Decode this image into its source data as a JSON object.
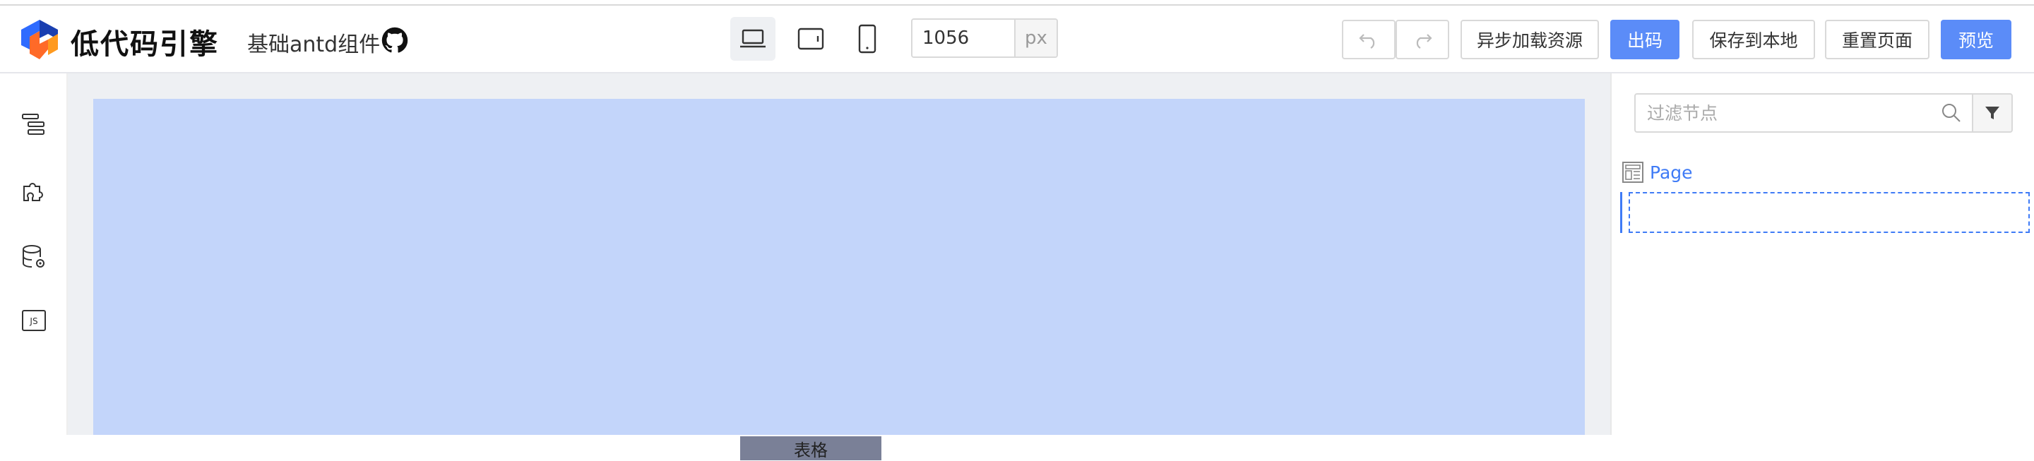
{
  "header": {
    "brand": "低代码引擎",
    "subtitle": "基础antd组件",
    "devices": [
      "desktop",
      "tablet",
      "phone"
    ],
    "active_device": "desktop",
    "canvas_width": "1056",
    "canvas_width_unit": "px",
    "buttons": {
      "undo": "undo-icon",
      "redo": "redo-icon",
      "async_load": "异步加载资源",
      "export_code": "出码",
      "save_local": "保存到本地",
      "reset_page": "重置页面",
      "preview": "预览"
    },
    "primary_color": "#5b8cf8"
  },
  "sidebar": {
    "items": [
      "outline-tree-icon",
      "component-puzzle-icon",
      "datasource-icon",
      "js-code-icon"
    ]
  },
  "canvas": {
    "drag_label": "表格",
    "background": "#c3d5fa"
  },
  "outline_panel": {
    "filter_placeholder": "过滤节点",
    "tree": [
      {
        "label": "Page",
        "icon": "page-icon"
      }
    ]
  }
}
